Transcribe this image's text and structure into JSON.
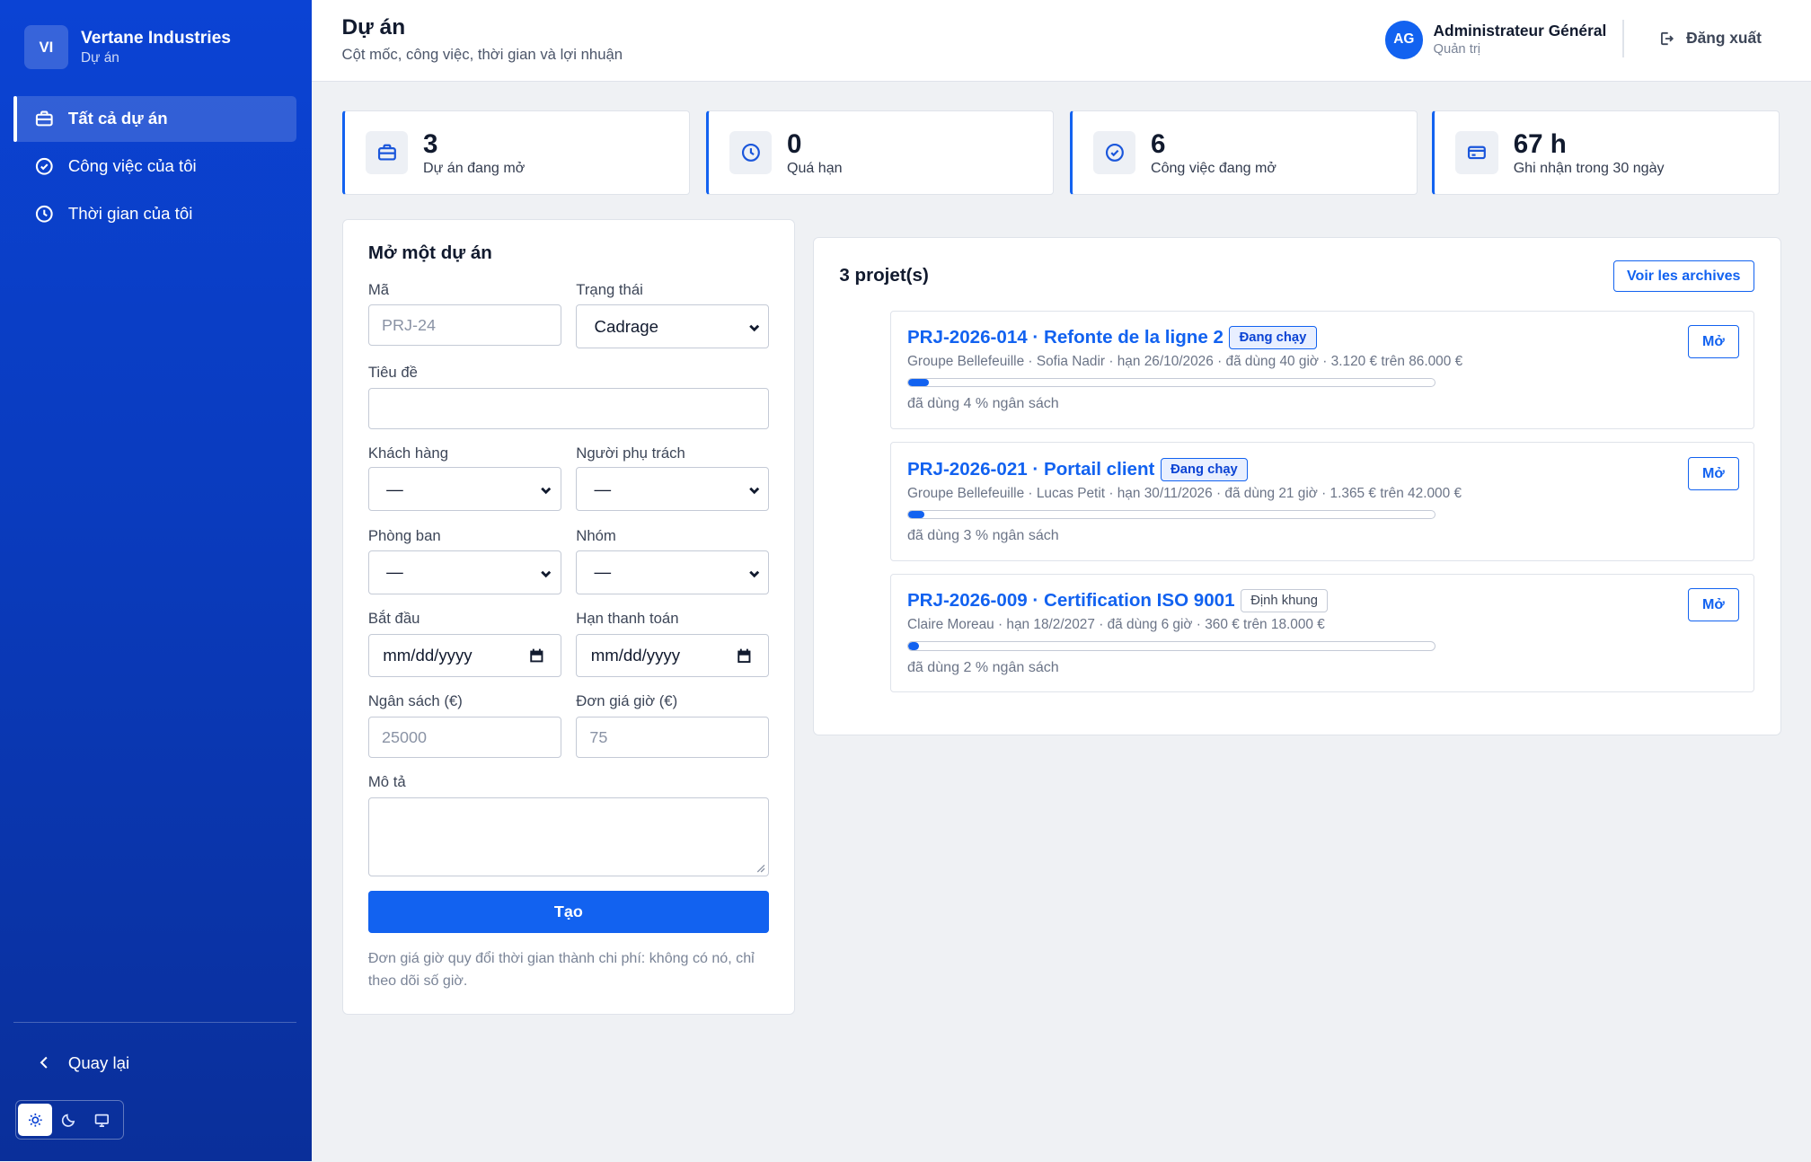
{
  "brand": {
    "initials": "VI",
    "name": "Vertane Industries",
    "sub": "Dự án"
  },
  "nav": {
    "items": [
      {
        "label": "Tất cả dự án",
        "icon": "briefcase-icon",
        "active": true
      },
      {
        "label": "Công việc của tôi",
        "icon": "check-circle-icon"
      },
      {
        "label": "Thời gian của tôi",
        "icon": "clock-icon"
      }
    ],
    "back_label": "Quay lại"
  },
  "theme": {
    "options": [
      "sun-icon",
      "moon-icon",
      "monitor-icon"
    ],
    "selected": "sun-icon"
  },
  "header": {
    "title": "Dự án",
    "subtitle": "Cột mốc, công việc, thời gian và lợi nhuận",
    "user": {
      "initials": "AG",
      "name": "Administrateur Général",
      "role": "Quản trị"
    },
    "logout_label": "Đăng xuất"
  },
  "stats": [
    {
      "value": "3",
      "label": "Dự án đang mở",
      "icon": "briefcase-icon"
    },
    {
      "value": "0",
      "label": "Quá hạn",
      "icon": "clock-icon"
    },
    {
      "value": "6",
      "label": "Công việc đang mở",
      "icon": "check-circle-icon"
    },
    {
      "value": "67 h",
      "label": "Ghi nhận trong 30 ngày",
      "icon": "credit-card-icon"
    }
  ],
  "form": {
    "title": "Mở một dự án",
    "code_label": "Mã",
    "code_placeholder": "PRJ-24",
    "status_label": "Trạng thái",
    "status_value": "Cadrage",
    "title_label": "Tiêu đề",
    "title_value": "",
    "client_label": "Khách hàng",
    "client_value": "—",
    "owner_label": "Người phụ trách",
    "owner_value": "—",
    "dept_label": "Phòng ban",
    "dept_value": "—",
    "team_label": "Nhóm",
    "team_value": "—",
    "start_label": "Bắt đầu",
    "start_value": "mm/dd/yyyy",
    "due_label": "Hạn thanh toán",
    "due_value": "mm/dd/yyyy",
    "budget_label": "Ngân sách (€)",
    "budget_placeholder": "25000",
    "rate_label": "Đơn giá giờ (€)",
    "rate_placeholder": "75",
    "desc_label": "Mô tả",
    "desc_value": "",
    "submit_label": "Tạo",
    "note": "Đơn giá giờ quy đổi thời gian thành chi phí: không có nó, chỉ theo dõi số giờ."
  },
  "projects": {
    "count_label": "3 projet(s)",
    "archives_label": "Voir les archives",
    "open_label": "Mở",
    "items": [
      {
        "title": "PRJ-2026-014 · Refonte de la ligne 2",
        "status": "Đang chạy",
        "status_style": "blue",
        "meta": "Groupe Bellefeuille · Sofia Nadir · hạn 26/10/2026 · đã dùng 40 giờ · 3.120 € trên 86.000 €",
        "budget_used_pct": 4,
        "budget_note": "đã dùng 4 % ngân sách"
      },
      {
        "title": "PRJ-2026-021 · Portail client",
        "status": "Đang chạy",
        "status_style": "blue",
        "meta": "Groupe Bellefeuille · Lucas Petit · hạn 30/11/2026 · đã dùng 21 giờ · 1.365 € trên 42.000 €",
        "budget_used_pct": 3,
        "budget_note": "đã dùng 3 % ngân sách"
      },
      {
        "title": "PRJ-2026-009 · Certification ISO 9001",
        "status": "Định khung",
        "status_style": "grey",
        "meta": "Claire Moreau · hạn 18/2/2027 · đã dùng 6 giờ · 360 € trên 18.000 €",
        "budget_used_pct": 2,
        "budget_note": "đã dùng 2 % ngân sách"
      }
    ]
  },
  "colors": {
    "accent": "#1262f0",
    "sidebar": "#0b43d4"
  }
}
